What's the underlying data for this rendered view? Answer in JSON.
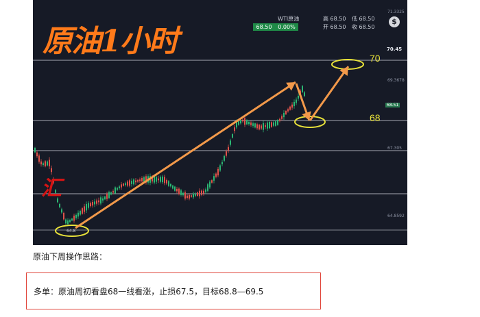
{
  "chart": {
    "title": "原油1小时",
    "red_mark": "汇",
    "quote": {
      "name": "WTI原油",
      "price": "68.50",
      "change_pct": "0.00%",
      "high_label": "高 68.50",
      "low_label": "低 68.50",
      "open_label": "开 68.50",
      "close_label": "收 68.50"
    },
    "dollar_icon": "$",
    "axis": {
      "top": "71.3325",
      "level_70": "70.45",
      "tick_a": "69.3678",
      "current": "68.51",
      "tick_b": "67.305",
      "tick_c": "64.8592"
    },
    "low_marker": "64.8",
    "levels": {
      "upper": "70",
      "lower": "68"
    },
    "colors": {
      "background": "#161a26",
      "up_candle": "#2bb673",
      "down_candle": "#e0524a",
      "arrow": "#f2994a",
      "ellipse": "#e8e23a",
      "level_line": "#c9ccd4"
    }
  },
  "caption": "原油下周操作思路：",
  "plan": "多单：原油周初看盘68一线看涨，止损67.5，目标68.8—69.5"
}
